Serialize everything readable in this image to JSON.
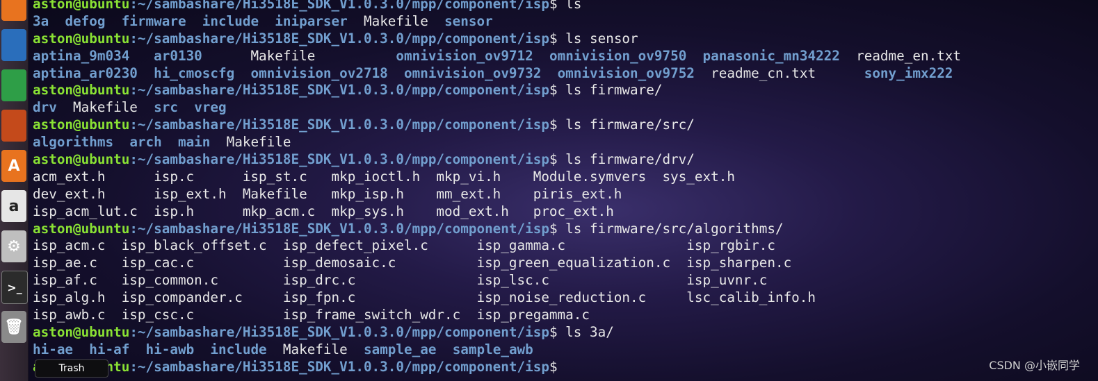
{
  "launcher": {
    "items": [
      {
        "name": "firefox-icon",
        "glyph": "",
        "bg": "#e8731f"
      },
      {
        "name": "writer-icon",
        "glyph": "",
        "bg": "#2a6ebb"
      },
      {
        "name": "calc-icon",
        "glyph": "",
        "bg": "#2e9e47"
      },
      {
        "name": "impress-icon",
        "glyph": "",
        "bg": "#c44a1b"
      },
      {
        "name": "software-center-icon",
        "glyph": "A",
        "bg": "#e8731f"
      },
      {
        "name": "amazon-icon",
        "glyph": "a",
        "bg": "#e6e6e6"
      },
      {
        "name": "settings-icon",
        "glyph": "⚙",
        "bg": "#bfbfbf"
      },
      {
        "name": "terminal-icon",
        "glyph": ">_",
        "bg": "#2b2b2b"
      },
      {
        "name": "trash-icon",
        "glyph": "🗑",
        "bg": "#8a8a8a"
      }
    ]
  },
  "trash_tooltip": "Trash",
  "terminal": {
    "user_host": "aston@ubuntu",
    "path": ":~/sambashare/Hi3518E_SDK_V1.0.3.0/mpp/component/isp",
    "lines": [
      {
        "type": "cmd",
        "cmd": " ls"
      },
      {
        "type": "out",
        "segments": [
          {
            "t": "3a",
            "c": "d"
          },
          {
            "t": "  "
          },
          {
            "t": "defog",
            "c": "d"
          },
          {
            "t": "  "
          },
          {
            "t": "firmware",
            "c": "d"
          },
          {
            "t": "  "
          },
          {
            "t": "include",
            "c": "d"
          },
          {
            "t": "  "
          },
          {
            "t": "iniparser",
            "c": "d"
          },
          {
            "t": "  "
          },
          {
            "t": "Makefile",
            "c": "f"
          },
          {
            "t": "  "
          },
          {
            "t": "sensor",
            "c": "d"
          }
        ]
      },
      {
        "type": "cmd",
        "cmd": " ls sensor"
      },
      {
        "type": "out",
        "segments": [
          {
            "t": "aptina_9m034",
            "c": "d"
          },
          {
            "t": "   "
          },
          {
            "t": "ar0130",
            "c": "d"
          },
          {
            "t": "      "
          },
          {
            "t": "Makefile",
            "c": "f"
          },
          {
            "t": "          "
          },
          {
            "t": "omnivision_ov9712",
            "c": "d"
          },
          {
            "t": "  "
          },
          {
            "t": "omnivision_ov9750",
            "c": "d"
          },
          {
            "t": "  "
          },
          {
            "t": "panasonic_mn34222",
            "c": "d"
          },
          {
            "t": "  "
          },
          {
            "t": "readme_en.txt",
            "c": "f"
          }
        ]
      },
      {
        "type": "out",
        "segments": [
          {
            "t": "aptina_ar0230",
            "c": "d"
          },
          {
            "t": "  "
          },
          {
            "t": "hi_cmoscfg",
            "c": "d"
          },
          {
            "t": "  "
          },
          {
            "t": "omnivision_ov2718",
            "c": "d"
          },
          {
            "t": "  "
          },
          {
            "t": "omnivision_ov9732",
            "c": "d"
          },
          {
            "t": "  "
          },
          {
            "t": "omnivision_ov9752",
            "c": "d"
          },
          {
            "t": "  "
          },
          {
            "t": "readme_cn.txt",
            "c": "f"
          },
          {
            "t": "      "
          },
          {
            "t": "sony_imx222",
            "c": "d"
          }
        ]
      },
      {
        "type": "cmd",
        "cmd": " ls firmware/"
      },
      {
        "type": "out",
        "segments": [
          {
            "t": "drv",
            "c": "d"
          },
          {
            "t": "  "
          },
          {
            "t": "Makefile",
            "c": "f"
          },
          {
            "t": "  "
          },
          {
            "t": "src",
            "c": "d"
          },
          {
            "t": "  "
          },
          {
            "t": "vreg",
            "c": "d"
          }
        ]
      },
      {
        "type": "cmd",
        "cmd": " ls firmware/src/"
      },
      {
        "type": "out",
        "segments": [
          {
            "t": "algorithms",
            "c": "d"
          },
          {
            "t": "  "
          },
          {
            "t": "arch",
            "c": "d"
          },
          {
            "t": "  "
          },
          {
            "t": "main",
            "c": "d"
          },
          {
            "t": "  "
          },
          {
            "t": "Makefile",
            "c": "f"
          }
        ]
      },
      {
        "type": "cmd",
        "cmd": " ls firmware/drv/"
      },
      {
        "type": "out",
        "segments": [
          {
            "t": "acm_ext.h      isp.c      isp_st.c   mkp_ioctl.h  mkp_vi.h    Module.symvers  sys_ext.h",
            "c": "f"
          }
        ]
      },
      {
        "type": "out",
        "segments": [
          {
            "t": "dev_ext.h      isp_ext.h  Makefile   mkp_isp.h    mm_ext.h    piris_ext.h",
            "c": "f"
          }
        ]
      },
      {
        "type": "out",
        "segments": [
          {
            "t": "isp_acm_lut.c  isp.h      mkp_acm.c  mkp_sys.h    mod_ext.h   proc_ext.h",
            "c": "f"
          }
        ]
      },
      {
        "type": "cmd",
        "cmd": " ls firmware/src/algorithms/"
      },
      {
        "type": "out",
        "segments": [
          {
            "t": "isp_acm.c  isp_black_offset.c  isp_defect_pixel.c      isp_gamma.c               isp_rgbir.c",
            "c": "f"
          }
        ]
      },
      {
        "type": "out",
        "segments": [
          {
            "t": "isp_ae.c   isp_cac.c           isp_demosaic.c          isp_green_equalization.c  isp_sharpen.c",
            "c": "f"
          }
        ]
      },
      {
        "type": "out",
        "segments": [
          {
            "t": "isp_af.c   isp_common.c        isp_drc.c               isp_lsc.c                 isp_uvnr.c",
            "c": "f"
          }
        ]
      },
      {
        "type": "out",
        "segments": [
          {
            "t": "isp_alg.h  isp_compander.c     isp_fpn.c               isp_noise_reduction.c     lsc_calib_info.h",
            "c": "f"
          }
        ]
      },
      {
        "type": "out",
        "segments": [
          {
            "t": "isp_awb.c  isp_csc.c           isp_frame_switch_wdr.c  isp_pregamma.c",
            "c": "f"
          }
        ]
      },
      {
        "type": "cmd",
        "cmd": " ls 3a/"
      },
      {
        "type": "out",
        "segments": [
          {
            "t": "hi-ae",
            "c": "d"
          },
          {
            "t": "  "
          },
          {
            "t": "hi-af",
            "c": "d"
          },
          {
            "t": "  "
          },
          {
            "t": "hi-awb",
            "c": "d"
          },
          {
            "t": "  "
          },
          {
            "t": "include",
            "c": "d"
          },
          {
            "t": "  "
          },
          {
            "t": "Makefile",
            "c": "f"
          },
          {
            "t": "  "
          },
          {
            "t": "sample_ae",
            "c": "d"
          },
          {
            "t": "  "
          },
          {
            "t": "sample_awb",
            "c": "d"
          }
        ]
      },
      {
        "type": "cmd",
        "cmd": " "
      }
    ]
  },
  "watermark": "CSDN @小嵌同学"
}
